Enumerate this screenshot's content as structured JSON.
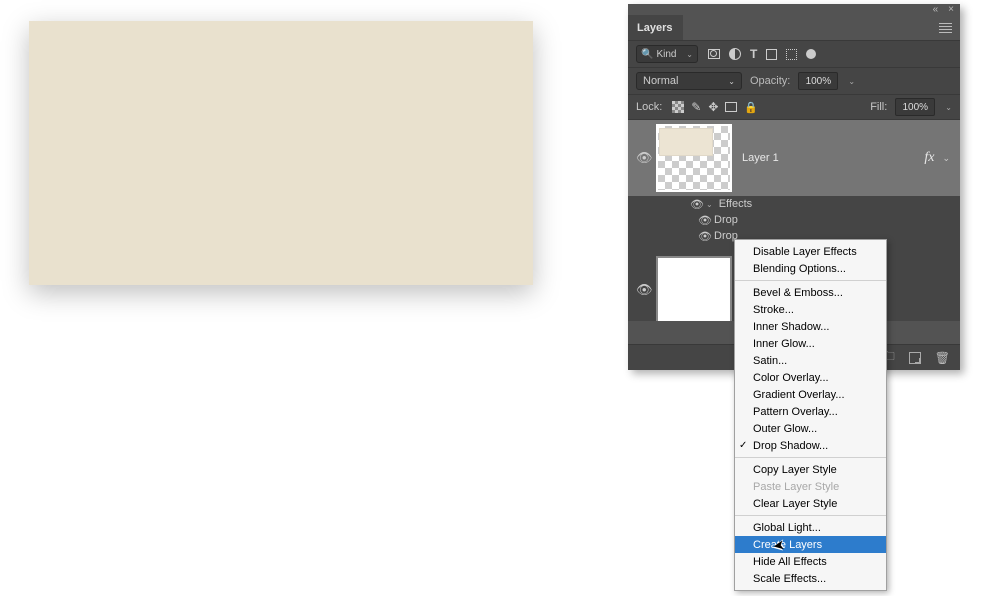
{
  "panel": {
    "title": "Layers",
    "collapse_label": "«",
    "close_label": "×",
    "filter": {
      "kind_label": "Kind",
      "search_icon": "search"
    },
    "blend_mode": "Normal",
    "opacity_label": "Opacity:",
    "opacity_value": "100%",
    "lock_label": "Lock:",
    "fill_label": "Fill:",
    "fill_value": "100%",
    "fx_indicator": "fx"
  },
  "layers": {
    "selected": {
      "name": "Layer 1",
      "effects_label": "Effects",
      "effect_items": [
        "Drop",
        "Drop"
      ]
    }
  },
  "contextMenu": {
    "group1": [
      "Disable Layer Effects",
      "Blending Options..."
    ],
    "group2": [
      "Bevel & Emboss...",
      "Stroke...",
      "Inner Shadow...",
      "Inner Glow...",
      "Satin...",
      "Color Overlay...",
      "Gradient Overlay...",
      "Pattern Overlay...",
      "Outer Glow...",
      "Drop Shadow..."
    ],
    "checked_index": 9,
    "group3_copy": "Copy Layer Style",
    "group3_paste": "Paste Layer Style",
    "group3_clear": "Clear Layer Style",
    "group4": [
      "Global Light...",
      "Create Layers",
      "Hide All Effects",
      "Scale Effects..."
    ],
    "hovered_index": 1
  }
}
